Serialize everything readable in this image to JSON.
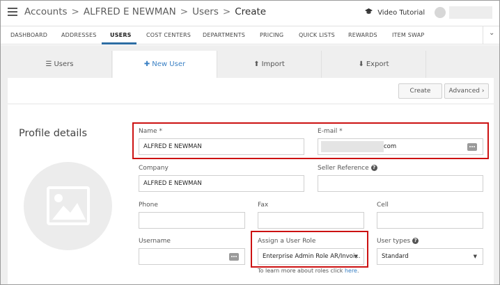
{
  "header": {
    "breadcrumb": [
      "Accounts",
      "ALFRED E NEWMAN",
      "Users",
      "Create"
    ],
    "separator": ">",
    "video_tutorial": "Video Tutorial",
    "icons": {
      "menu": "hamburger-icon",
      "video": "graduation-cap-icon",
      "user": "user-avatar-icon"
    }
  },
  "nav": {
    "items": [
      "DASHBOARD",
      "ADDRESSES",
      "USERS",
      "COST CENTERS",
      "DEPARTMENTS",
      "PRICING",
      "QUICK LISTS",
      "REWARDS",
      "ITEM SWAP"
    ],
    "active": "USERS",
    "more_icon": "chevron-down-icon"
  },
  "subtabs": [
    {
      "label": "Users",
      "icon": "list-icon"
    },
    {
      "label": "New User",
      "icon": "plus-icon",
      "active": true
    },
    {
      "label": "Import",
      "icon": "upload-icon"
    },
    {
      "label": "Export",
      "icon": "download-icon"
    }
  ],
  "actions": {
    "create": "Create",
    "advanced": "Advanced"
  },
  "profile": {
    "title": "Profile details",
    "name_label": "Name",
    "name_value": "ALFRED E NEWMAN",
    "email_label": "E-mail",
    "email_suffix": "com",
    "required_mark": "*",
    "company_label": "Company",
    "company_value": "ALFRED E NEWMAN",
    "seller_ref_label": "Seller Reference",
    "phone_label": "Phone",
    "fax_label": "Fax",
    "cell_label": "Cell",
    "username_label": "Username",
    "role_label": "Assign a User Role",
    "role_value": "Enterprise Admin Role AR/Invoi...",
    "user_types_label": "User types",
    "user_types_value": "Standard",
    "role_hint_prefix": "To learn more about roles click",
    "role_hint_link": "here",
    "role_hint_suffix": "."
  },
  "colors": {
    "accent": "#3a80c4",
    "highlight": "#cc1111",
    "nav_underline": "#2d6da3"
  }
}
